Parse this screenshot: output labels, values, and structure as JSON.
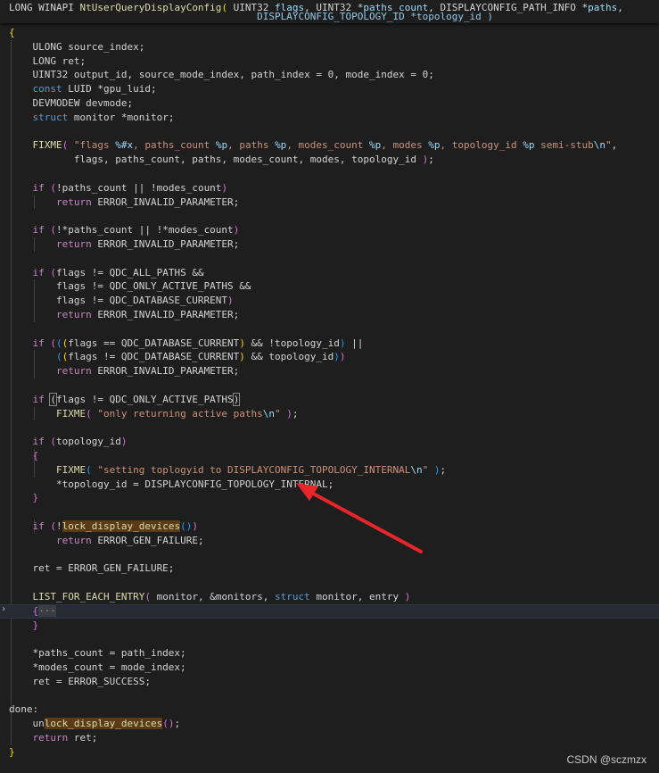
{
  "editor": {
    "sticky": {
      "line1": [
        [
          "t",
          "LONG WINAPI "
        ],
        [
          "fn",
          "NtUserQueryDisplayConfig"
        ],
        [
          "brk",
          "("
        ],
        [
          "t",
          " UINT32 "
        ],
        [
          "var",
          "flags"
        ],
        [
          "t",
          ", UINT32 *"
        ],
        [
          "var",
          "paths_count"
        ],
        [
          "t",
          ", DISPLAYCONFIG_PATH_INFO *"
        ],
        [
          "var",
          "paths"
        ],
        [
          "t",
          ","
        ]
      ],
      "line2": "                                          DISPLAYCONFIG_TOPOLOGY_ID *topology_id )"
    },
    "lines": [
      [
        [
          "brk",
          "{"
        ]
      ],
      [
        [
          "t",
          "    ULONG source_index;"
        ]
      ],
      [
        [
          "t",
          "    LONG ret;"
        ]
      ],
      [
        [
          "t",
          "    UINT32 output_id, source_mode_index, path_index = 0, mode_index = 0;"
        ]
      ],
      [
        [
          "t",
          "    "
        ],
        [
          "kw",
          "const"
        ],
        [
          "t",
          " LUID *gpu_luid;"
        ]
      ],
      [
        [
          "t",
          "    DEVMODEW devmode;"
        ]
      ],
      [
        [
          "t",
          "    "
        ],
        [
          "kw",
          "struct"
        ],
        [
          "t",
          " monitor *monitor;"
        ]
      ],
      [],
      [
        [
          "t",
          "    "
        ],
        [
          "fn",
          "FIXME"
        ],
        [
          "brk2",
          "("
        ],
        [
          "t",
          " "
        ],
        [
          "str",
          "\"flags "
        ],
        [
          "fmt",
          "%#x"
        ],
        [
          "str",
          ", paths_count "
        ],
        [
          "fmt",
          "%p"
        ],
        [
          "str",
          ", paths "
        ],
        [
          "fmt",
          "%p"
        ],
        [
          "str",
          ", modes_count "
        ],
        [
          "fmt",
          "%p"
        ],
        [
          "str",
          ", modes "
        ],
        [
          "fmt",
          "%p"
        ],
        [
          "str",
          ", topology_id "
        ],
        [
          "fmt",
          "%p"
        ],
        [
          "str",
          " semi-stub"
        ],
        [
          "fmt",
          "\\n"
        ],
        [
          "str",
          "\""
        ],
        [
          "t",
          ","
        ]
      ],
      [
        [
          "t",
          "           flags, paths_count, paths, modes_count, modes, topology_id "
        ],
        [
          "brk2",
          ")"
        ],
        [
          "t",
          ";"
        ]
      ],
      [],
      [
        [
          "t",
          "    "
        ],
        [
          "ctl",
          "if"
        ],
        [
          "t",
          " "
        ],
        [
          "brk2",
          "("
        ],
        [
          "t",
          "!paths_count || !modes_count"
        ],
        [
          "brk2",
          ")"
        ]
      ],
      [
        [
          "t",
          "        "
        ],
        [
          "ctl",
          "return"
        ],
        [
          "t",
          " ERROR_INVALID_PARAMETER;"
        ]
      ],
      [],
      [
        [
          "t",
          "    "
        ],
        [
          "ctl",
          "if"
        ],
        [
          "t",
          " "
        ],
        [
          "brk2",
          "("
        ],
        [
          "t",
          "!*paths_count || !*modes_count"
        ],
        [
          "brk2",
          ")"
        ]
      ],
      [
        [
          "t",
          "        "
        ],
        [
          "ctl",
          "return"
        ],
        [
          "t",
          " ERROR_INVALID_PARAMETER;"
        ]
      ],
      [],
      [
        [
          "t",
          "    "
        ],
        [
          "ctl",
          "if"
        ],
        [
          "t",
          " "
        ],
        [
          "brk2",
          "("
        ],
        [
          "t",
          "flags != QDC_ALL_PATHS &&"
        ]
      ],
      [
        [
          "t",
          "        flags != QDC_ONLY_ACTIVE_PATHS &&"
        ]
      ],
      [
        [
          "t",
          "        flags != QDC_DATABASE_CURRENT"
        ],
        [
          "brk2",
          ")"
        ]
      ],
      [
        [
          "t",
          "        "
        ],
        [
          "ctl",
          "return"
        ],
        [
          "t",
          " ERROR_INVALID_PARAMETER;"
        ]
      ],
      [],
      [
        [
          "t",
          "    "
        ],
        [
          "ctl",
          "if"
        ],
        [
          "t",
          " "
        ],
        [
          "brk2",
          "("
        ],
        [
          "brk3",
          "("
        ],
        [
          "brk",
          "("
        ],
        [
          "t",
          "flags == QDC_DATABASE_CURRENT"
        ],
        [
          "brk",
          ")"
        ],
        [
          "t",
          " && !topology_id"
        ],
        [
          "brk3",
          ")"
        ],
        [
          "t",
          " ||"
        ]
      ],
      [
        [
          "t",
          "        "
        ],
        [
          "brk3",
          "("
        ],
        [
          "brk",
          "("
        ],
        [
          "t",
          "flags != QDC_DATABASE_CURRENT"
        ],
        [
          "brk",
          ")"
        ],
        [
          "t",
          " && topology_id"
        ],
        [
          "brk3",
          ")"
        ],
        [
          "brk2",
          ")"
        ]
      ],
      [
        [
          "t",
          "        "
        ],
        [
          "ctl",
          "return"
        ],
        [
          "t",
          " ERROR_INVALID_PARAMETER;"
        ]
      ],
      [],
      [
        [
          "t",
          "    "
        ],
        [
          "ctl",
          "if"
        ],
        [
          "t",
          " "
        ],
        [
          "box",
          "("
        ],
        [
          "t",
          "flags != QDC_ONLY_ACTIVE_PATHS"
        ],
        [
          "box",
          ")"
        ]
      ],
      [
        [
          "t",
          "        "
        ],
        [
          "fn",
          "FIXME"
        ],
        [
          "brk2",
          "("
        ],
        [
          "t",
          " "
        ],
        [
          "str",
          "\"only returning active paths"
        ],
        [
          "fmt",
          "\\n"
        ],
        [
          "str",
          "\""
        ],
        [
          "t",
          " "
        ],
        [
          "brk2",
          ")"
        ],
        [
          "t",
          ";"
        ]
      ],
      [],
      [
        [
          "t",
          "    "
        ],
        [
          "ctl",
          "if"
        ],
        [
          "t",
          " "
        ],
        [
          "brk2",
          "("
        ],
        [
          "t",
          "topology_id"
        ],
        [
          "brk2",
          ")"
        ]
      ],
      [
        [
          "t",
          "    "
        ],
        [
          "brk2",
          "{"
        ]
      ],
      [
        [
          "t",
          "        "
        ],
        [
          "fn",
          "FIXME"
        ],
        [
          "brk3",
          "("
        ],
        [
          "t",
          " "
        ],
        [
          "str",
          "\"setting toplogyid to DISPLAYCONFIG_TOPOLOGY_INTERNAL"
        ],
        [
          "fmt",
          "\\n"
        ],
        [
          "str",
          "\""
        ],
        [
          "t",
          " "
        ],
        [
          "brk3",
          ")"
        ],
        [
          "t",
          ";"
        ]
      ],
      [
        [
          "t",
          "        *topology_id = DISPLAYCONFIG_TOPOLOGY_INTERNAL;"
        ]
      ],
      [
        [
          "t",
          "    "
        ],
        [
          "brk2",
          "}"
        ]
      ],
      [],
      [
        [
          "t",
          "    "
        ],
        [
          "ctl",
          "if"
        ],
        [
          "t",
          " "
        ],
        [
          "brk2",
          "("
        ],
        [
          "t",
          "!"
        ],
        [
          "hl",
          "lock_display_devices"
        ],
        [
          "brk3",
          "()"
        ],
        [
          "brk2",
          ")"
        ]
      ],
      [
        [
          "t",
          "        "
        ],
        [
          "ctl",
          "return"
        ],
        [
          "t",
          " ERROR_GEN_FAILURE;"
        ]
      ],
      [],
      [
        [
          "t",
          "    ret = ERROR_GEN_FAILURE;"
        ]
      ],
      [],
      [
        [
          "t",
          "    "
        ],
        [
          "fn",
          "LIST_FOR_EACH_ENTRY"
        ],
        [
          "brk2",
          "("
        ],
        [
          "t",
          " monitor, &monitors, "
        ],
        [
          "kw",
          "struct"
        ],
        [
          "t",
          " monitor, entry "
        ],
        [
          "brk2",
          ")"
        ]
      ],
      [
        [
          "t",
          "    "
        ],
        [
          "brk2",
          "{"
        ],
        [
          "fold",
          "···"
        ]
      ],
      [
        [
          "t",
          "    "
        ],
        [
          "brk2",
          "}"
        ]
      ],
      [],
      [
        [
          "t",
          "    *paths_count = path_index;"
        ]
      ],
      [
        [
          "t",
          "    *modes_count = mode_index;"
        ]
      ],
      [
        [
          "t",
          "    ret = ERROR_SUCCESS;"
        ]
      ],
      [],
      [
        [
          "t",
          "done:"
        ]
      ],
      [
        [
          "t",
          "    un"
        ],
        [
          "hl",
          "lock_display_devices"
        ],
        [
          "brk2",
          "()"
        ],
        [
          "t",
          ";"
        ]
      ],
      [
        [
          "t",
          "    "
        ],
        [
          "ctl",
          "return"
        ],
        [
          "t",
          " ret;"
        ]
      ],
      [
        [
          "brk",
          "}"
        ]
      ]
    ]
  },
  "colors": {
    "background": "#1e1e1e",
    "keyword": "#569cd6",
    "control": "#c586c0",
    "function": "#dcdcaa",
    "string": "#ce9178",
    "arrow": "#e8262a"
  },
  "watermark": "CSDN @sczmzx"
}
